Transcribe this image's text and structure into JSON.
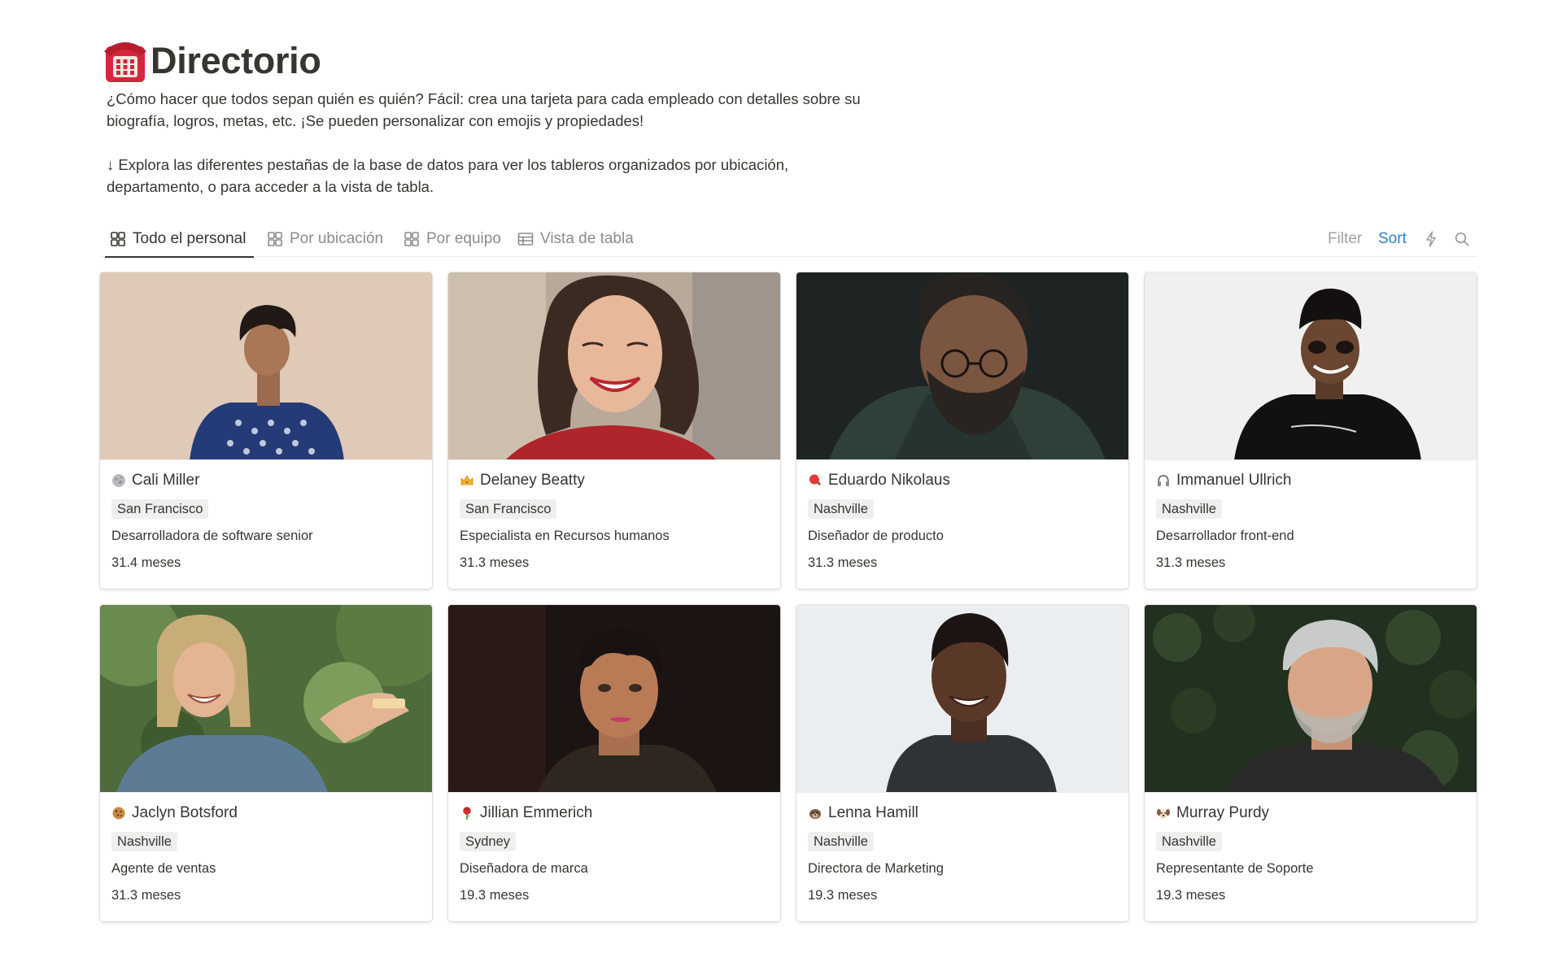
{
  "page": {
    "title": "Directorio",
    "title_icon": "telephone-icon",
    "description": [
      "¿Cómo hacer que todos sepan quién es quién? Fácil: crea una tarjeta para cada empleado con detalles sobre su",
      "biografía, logros, metas, etc. ¡Se pueden personalizar con emojis y propiedades!",
      "↓ Explora las diferentes pestañas de la base de datos para ver los tableros organizados por ubicación,",
      "departamento, o para acceder a la vista de tabla."
    ]
  },
  "tabs": [
    {
      "label": "Todo el personal",
      "icon": "gallery-icon",
      "active": true
    },
    {
      "label": "Por ubicación",
      "icon": "gallery-icon",
      "active": false
    },
    {
      "label": "Por equipo",
      "icon": "gallery-icon",
      "active": false
    },
    {
      "label": "Vista de tabla",
      "icon": "table-icon",
      "active": false
    }
  ],
  "toolbar": {
    "filter_label": "Filter",
    "sort_label": "Sort",
    "automation_icon": "lightning-icon",
    "search_icon": "search-icon"
  },
  "colors": {
    "text": "#37352f",
    "muted": "#8d8b87",
    "sort_accent": "#2f81c8",
    "tag_bg": "#efefed"
  },
  "cards": [
    {
      "name": "Cali Miller",
      "emoji": "moon-icon",
      "location": "San Francisco",
      "role": "Desarrolladora de software senior",
      "tenure": "31.4 meses",
      "photo": "person-looking-up-photo"
    },
    {
      "name": "Delaney Beatty",
      "emoji": "crown-icon",
      "location": "San Francisco",
      "role": "Especialista en Recursos humanos",
      "tenure": "31.3 meses",
      "photo": "smiling-woman-photo"
    },
    {
      "name": "Eduardo Nikolaus",
      "emoji": "ping-pong-icon",
      "location": "Nashville",
      "role": "Diseñador de producto",
      "tenure": "31.3 meses",
      "photo": "bearded-man-glasses-photo"
    },
    {
      "name": "Immanuel Ullrich",
      "emoji": "headphones-icon",
      "location": "Nashville",
      "role": "Desarrollador front-end",
      "tenure": "31.3 meses",
      "photo": "man-sunglasses-photo"
    },
    {
      "name": "Jaclyn Botsford",
      "emoji": "cookie-icon",
      "location": "Nashville",
      "role": "Agente de ventas",
      "tenure": "31.3 meses",
      "photo": "laughing-woman-outdoors-photo"
    },
    {
      "name": "Jillian Emmerich",
      "emoji": "rose-icon",
      "location": "Sydney",
      "role": "Diseñadora de marca",
      "tenure": "19.3 meses",
      "photo": "woman-portrait-dark-photo"
    },
    {
      "name": "Lenna Hamill",
      "emoji": "otter-icon",
      "location": "Nashville",
      "role": "Directora de Marketing",
      "tenure": "19.3 meses",
      "photo": "laughing-woman-white-photo"
    },
    {
      "name": "Murray Purdy",
      "emoji": "dog-icon",
      "location": "Nashville",
      "role": "Representante de Soporte",
      "tenure": "19.3 meses",
      "photo": "grey-haired-man-photo"
    }
  ]
}
